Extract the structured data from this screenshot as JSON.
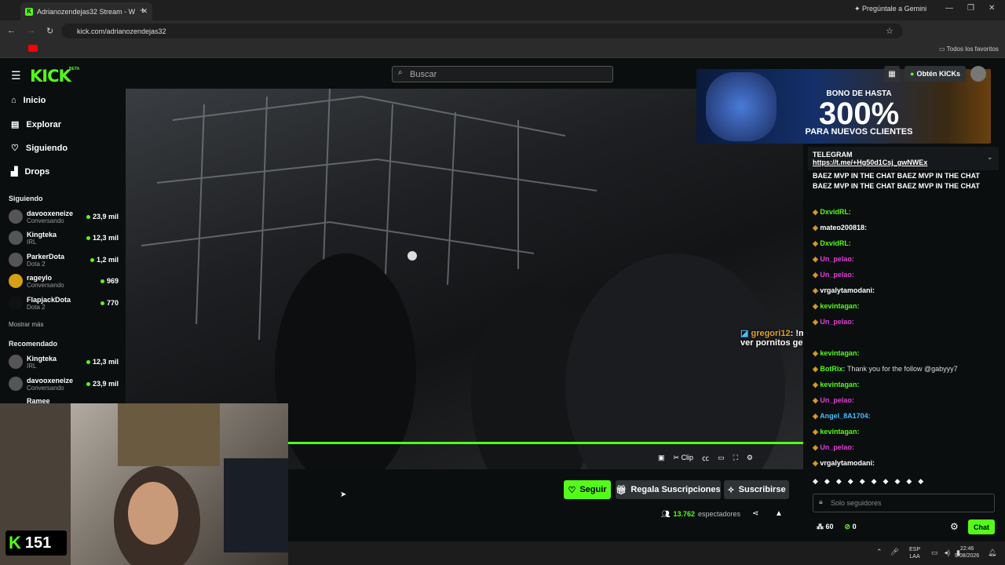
{
  "browser": {
    "tab_title": "Adrianozendejas32 Stream - W",
    "gemini": "Pregúntale a Gemini",
    "url": "kick.com/adrianozendejas32",
    "favorites": "Todos los favoritos"
  },
  "header": {
    "logo": "KICK",
    "beta": "BETA",
    "search_placeholder": "Buscar",
    "get_kicks": "Obtén KICKs"
  },
  "nav": [
    {
      "label": "Inicio",
      "icon": "home-icon"
    },
    {
      "label": "Explorar",
      "icon": "compass-icon"
    },
    {
      "label": "Siguiendo",
      "icon": "heart-icon"
    },
    {
      "label": "Drops",
      "icon": "drops-icon"
    }
  ],
  "following": {
    "title": "Siguiendo",
    "show_more": "Mostrar más",
    "channels": [
      {
        "name": "davooxeneize",
        "cat": "Conversando",
        "viewers": "23,9 mil"
      },
      {
        "name": "Kingteka",
        "cat": "IRL",
        "viewers": "12,3 mil"
      },
      {
        "name": "ParkerDota",
        "cat": "Dota 2",
        "viewers": "1,2 mil"
      },
      {
        "name": "rageylo",
        "cat": "Conversando",
        "viewers": "969"
      },
      {
        "name": "FlapjackDota",
        "cat": "Dota 2",
        "viewers": "770"
      }
    ]
  },
  "recommended": {
    "title": "Recomendado",
    "channels": [
      {
        "name": "Kingteka",
        "cat": "IRL",
        "viewers": "12,3 mil"
      },
      {
        "name": "davooxeneize",
        "cat": "Conversando",
        "viewers": "23,9 mil"
      },
      {
        "name": "Ramee",
        "cat": "",
        "viewers": ""
      }
    ]
  },
  "player": {
    "clip": "Clip",
    "overlay_user": "gregori12",
    "overlay_msg": ": !mura asi enfermo como tu que le gusta ver pornitos gey"
  },
  "actions": {
    "follow": "Seguir",
    "gift": "Regala Suscripciones",
    "subscribe": "Suscribirse",
    "viewers": "13.762",
    "viewers_label": "espectadores"
  },
  "webcam": {
    "count": "151"
  },
  "ad": {
    "line1": "BONO DE HASTA",
    "line2": "300%",
    "line3": "PARA NUEVOS CLIENTES"
  },
  "chat": {
    "pinned_title": "TELEGRAM",
    "pinned_link": "https://t.me/+Hg50d1Csj_gwNWEx",
    "spam": "BAEZ MVP IN THE CHAT BAEZ MVP IN THE CHAT BAEZ MVP IN THE CHAT BAEZ MVP IN THE CHAT",
    "messages": [
      {
        "user": "DxvidRL:",
        "color": "#53fc18",
        "text": ""
      },
      {
        "user": "mateo200818:",
        "color": "#ffffff",
        "text": ""
      },
      {
        "user": "DxvidRL:",
        "color": "#53fc18",
        "text": ""
      },
      {
        "user": "Un_pelao:",
        "color": "#e23bd8",
        "text": ""
      },
      {
        "user": "Un_pelao:",
        "color": "#e23bd8",
        "text": ""
      },
      {
        "user": "vrgalytamodani:",
        "color": "#ffffff",
        "text": ""
      },
      {
        "user": "kevintagan:",
        "color": "#53fc18",
        "text": ""
      },
      {
        "user": "Un_pelao:",
        "color": "#e23bd8",
        "text": ""
      },
      {
        "user": "kevintagan:",
        "color": "#53fc18",
        "text": ""
      },
      {
        "user": "BotRix:",
        "color": "#53fc18",
        "text": "Thank you for the follow @gabyyy7"
      },
      {
        "user": "kevintagan:",
        "color": "#53fc18",
        "text": ""
      },
      {
        "user": "Un_pelao:",
        "color": "#e23bd8",
        "text": ""
      },
      {
        "user": "Angel_8A1704:",
        "color": "#40c0ff",
        "text": ""
      },
      {
        "user": "kevintagan:",
        "color": "#53fc18",
        "text": ""
      },
      {
        "user": "Un_pelao:",
        "color": "#e23bd8",
        "text": ""
      },
      {
        "user": "vrgalytamodani:",
        "color": "#ffffff",
        "text": ""
      }
    ],
    "input_placeholder": "Solo seguidores",
    "count1": "60",
    "count2": "0",
    "send": "Chat"
  },
  "taskbar": {
    "lang1": "ESP",
    "lang2": "LAA",
    "time": "22:46",
    "date": "9/08/2026"
  }
}
